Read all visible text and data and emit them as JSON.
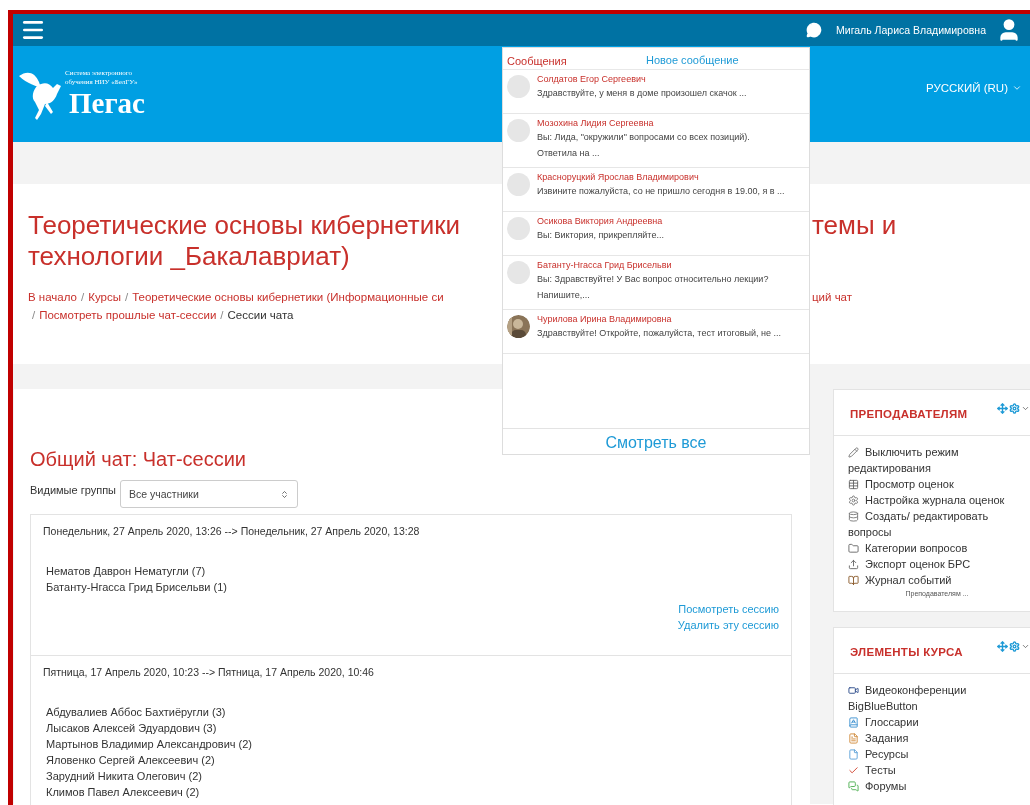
{
  "topbar": {
    "user_name": "Мигаль Лариса Владимировна"
  },
  "header": {
    "logo_subtitle_1": "Система электронного",
    "logo_subtitle_2": "обучения НИУ «БелГУ»",
    "logo_title": "Пегас",
    "language": "РУССКИЙ (RU)"
  },
  "page_title": {
    "line_1_left": "Теоретические основы кибернетики",
    "line_1_right": "темы и",
    "line_2": "технологии _Бакалавриат)"
  },
  "breadcrumb": {
    "separator": "/",
    "line_1": [
      {
        "label": "В начало",
        "link": true
      },
      {
        "label": "Курсы",
        "link": true
      },
      {
        "label": "Теоретические основы кибернетики (Информационные си",
        "link": true
      }
    ],
    "line_1_right": {
      "label": "ций чат",
      "link": true
    },
    "line_2": [
      {
        "label": "Посмотреть прошлые чат-сессии",
        "link": true
      },
      {
        "label": "Сессии чата",
        "link": false
      }
    ]
  },
  "chat": {
    "heading": "Общий чат: Чат-сессии",
    "group_filter": {
      "label": "Видимые группы",
      "value": "Все участники"
    },
    "sessions": [
      {
        "period": "Понедельник, 27 Апрель 2020, 13:26 --> Понедельник, 27 Апрель 2020, 13:28",
        "participants": [
          "Нематов Даврон Нематугли (7)",
          "Батанту-Нгасса Грид Брисельви (1)"
        ],
        "actions": [
          "Посмотреть сессию",
          "Удалить эту сессию"
        ]
      },
      {
        "period": "Пятница, 17 Апрель 2020, 10:23 --> Пятница, 17 Апрель 2020, 10:46",
        "participants": [
          "Абдувалиев Аббос Бахтиёругли (3)",
          "Лысаков Алексей Эдуардович (3)",
          "Мартынов Владимир Александрович (2)",
          "Яловенко Сергей Алексеевич (2)",
          "Зарудний Никита Олегович (2)",
          "Климов Павел Алексеевич (2)"
        ]
      }
    ]
  },
  "blocks": [
    {
      "title": "ПРЕПОДАВАТЕЛЯМ",
      "items": [
        {
          "kind": "pencil",
          "label": "Выключить режим редактирования"
        },
        {
          "kind": "table",
          "label": "Просмотр оценок"
        },
        {
          "kind": "gear",
          "label": "Настройка журнала оценок"
        },
        {
          "kind": "database",
          "label": "Создать/ редактировать вопросы"
        },
        {
          "kind": "folder",
          "label": "Категории вопросов"
        },
        {
          "kind": "upload",
          "label": "Экспорт оценок БРС"
        },
        {
          "kind": "journal",
          "label": "Журнал событий"
        }
      ],
      "more": "Преподавателям ..."
    },
    {
      "title": "ЭЛЕМЕНТЫ КУРСА",
      "items": [
        {
          "kind": "video",
          "label": "Видеоконференции BigBlueButton"
        },
        {
          "kind": "glossary",
          "label": "Глоссарии"
        },
        {
          "kind": "assignment",
          "label": "Задания"
        },
        {
          "kind": "resource",
          "label": "Ресурсы"
        },
        {
          "kind": "quiz",
          "label": "Тесты"
        },
        {
          "kind": "forum",
          "label": "Форумы"
        }
      ]
    }
  ],
  "messages": {
    "title": "Сообщения",
    "new_message": "Новое сообщение",
    "view_all": "Смотреть все",
    "items": [
      {
        "name": "Солдатов Егор Сергеевич",
        "text": "Здравствуйте, у меня в доме произошел скачок ...",
        "kind": "placeholder"
      },
      {
        "name": "Мозохина Лидия Сергеевна",
        "text": "Вы: Лида, \"окружили\" вопросами со всех позиций). Ответила на ...",
        "kind": "placeholder"
      },
      {
        "name": "Красноруцкий Ярослав Владимирович",
        "text": "Извините пожалуйста, со не пришло сегодня в 19.00, я в ...",
        "kind": "placeholder"
      },
      {
        "name": "Осикова Виктория Андреевна",
        "text": "Вы: Виктория, прикрепляйте...",
        "kind": "placeholder"
      },
      {
        "name": "Батанту-Нгасса Грид Брисельви",
        "text": "Вы: Здравствуйте! У Вас вопрос относительно лекции? Напишите,...",
        "kind": "placeholder"
      },
      {
        "name": "Чурилова Ирина Владимировна",
        "text": "Здравствуйте! Откройте, пожалуйста, тест итоговый, не ..."
      }
    ]
  }
}
